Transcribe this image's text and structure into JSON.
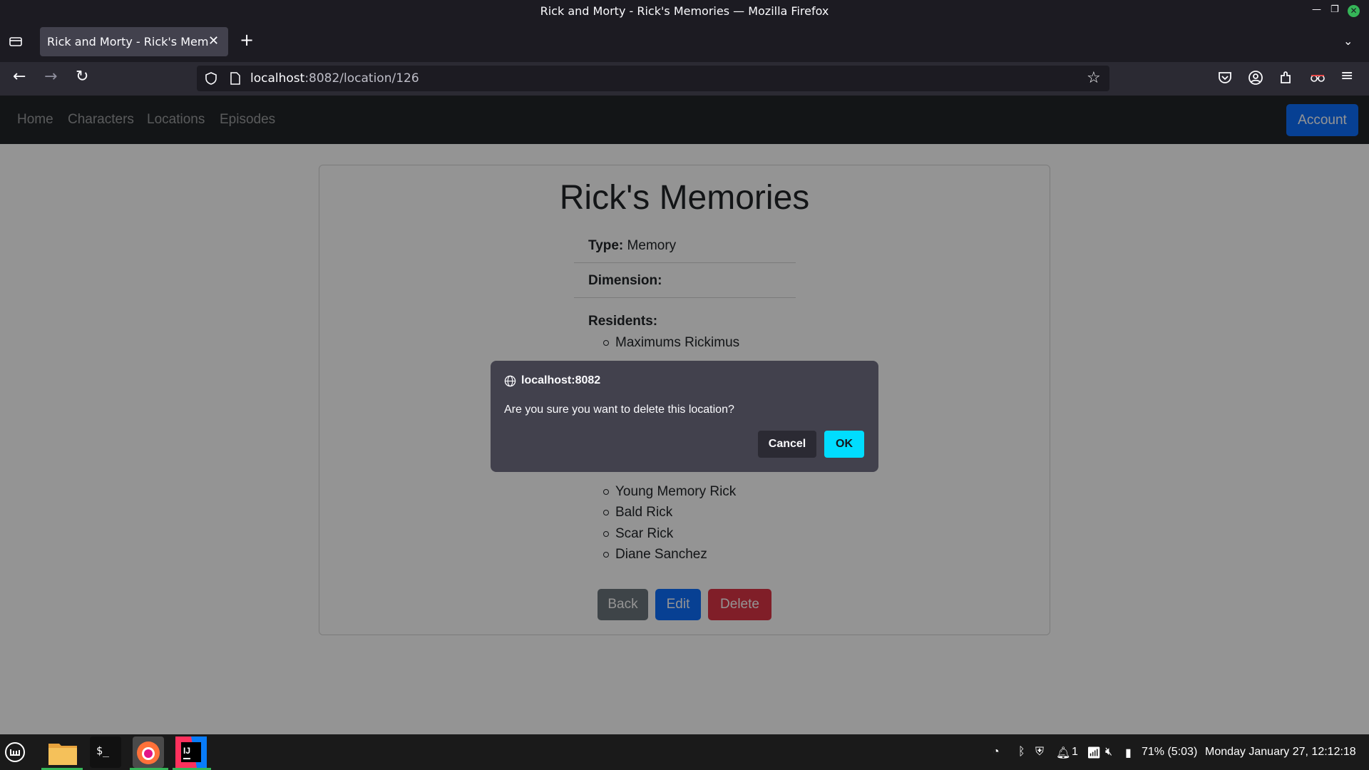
{
  "window": {
    "title": "Rick and Morty - Rick's Memories — Mozilla Firefox"
  },
  "browser": {
    "tab_title": "Rick and Morty - Rick's Memories",
    "url_host": "localhost",
    "url_rest": ":8082/location/126"
  },
  "site_nav": {
    "links": [
      "Home",
      "Characters",
      "Locations",
      "Episodes"
    ],
    "account_label": "Account"
  },
  "location": {
    "name": "Rick's Memories",
    "type_label": "Type:",
    "type_value": "Memory",
    "dimension_label": "Dimension:",
    "dimension_value": "",
    "residents_label": "Residents:",
    "residents_top": [
      "Maximums Rickimus"
    ],
    "residents_bottom": [
      "Young Memory Rick",
      "Bald Rick",
      "Scar Rick",
      "Diane Sanchez"
    ]
  },
  "actions": {
    "back": "Back",
    "edit": "Edit",
    "delete": "Delete"
  },
  "dialog": {
    "origin": "localhost:8082",
    "message": "Are you sure you want to delete this location?",
    "cancel": "Cancel",
    "ok": "OK"
  },
  "taskbar": {
    "tray_count": "1",
    "battery": "71% (5:03)",
    "clock": "Monday January 27, 12:12:18"
  },
  "colors": {
    "accent_primary": "#0d6efd",
    "danger": "#dc3545",
    "secondary": "#6c757d",
    "dialog_ok": "#00ddff",
    "active_indicator": "#35b558"
  }
}
